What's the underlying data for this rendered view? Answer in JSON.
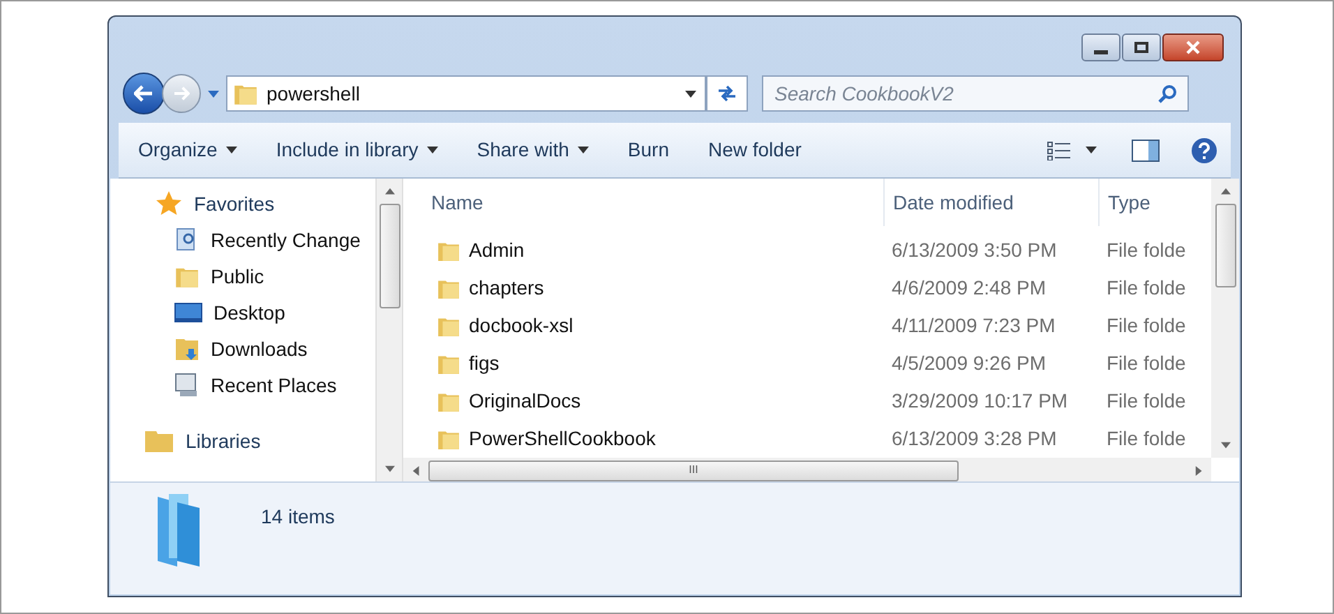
{
  "window": {
    "controls": [
      {
        "kind": "minimize"
      },
      {
        "kind": "maximize"
      },
      {
        "kind": "close"
      }
    ]
  },
  "address": {
    "value": "powershell"
  },
  "search": {
    "placeholder": "Search CookbookV2"
  },
  "toolbar": {
    "items": [
      {
        "label": "Organize",
        "dropdown": true
      },
      {
        "label": "Include in library",
        "dropdown": true
      },
      {
        "label": "Share with",
        "dropdown": true
      },
      {
        "label": "Burn",
        "dropdown": false
      },
      {
        "label": "New folder",
        "dropdown": false
      }
    ]
  },
  "sidebar": {
    "items": [
      {
        "label": "Favorites",
        "kind": "star",
        "heading": true
      },
      {
        "label": "Recently Change",
        "kind": "recent",
        "heading": false
      },
      {
        "label": "Public",
        "kind": "folder",
        "heading": false
      },
      {
        "label": "Desktop",
        "kind": "desktop",
        "heading": false
      },
      {
        "label": "Downloads",
        "kind": "downloads",
        "heading": false
      },
      {
        "label": "Recent Places",
        "kind": "places",
        "heading": false
      },
      {
        "label": "Libraries",
        "kind": "library",
        "heading": true
      }
    ]
  },
  "table": {
    "columns": [
      "Name",
      "Date modified",
      "Type"
    ],
    "rows": [
      {
        "name": "Admin",
        "date": "6/13/2009 3:50 PM",
        "type": "File folde"
      },
      {
        "name": "chapters",
        "date": "4/6/2009 2:48 PM",
        "type": "File folde"
      },
      {
        "name": "docbook-xsl",
        "date": "4/11/2009 7:23 PM",
        "type": "File folde"
      },
      {
        "name": "figs",
        "date": "4/5/2009 9:26 PM",
        "type": "File folde"
      },
      {
        "name": "OriginalDocs",
        "date": "3/29/2009 10:17 PM",
        "type": "File folde"
      },
      {
        "name": "PowerShellCookbook",
        "date": "6/13/2009 3:28 PM",
        "type": "File folde"
      }
    ]
  },
  "scrollbar_grip": "III",
  "status_bar": {
    "count": "14 items"
  }
}
